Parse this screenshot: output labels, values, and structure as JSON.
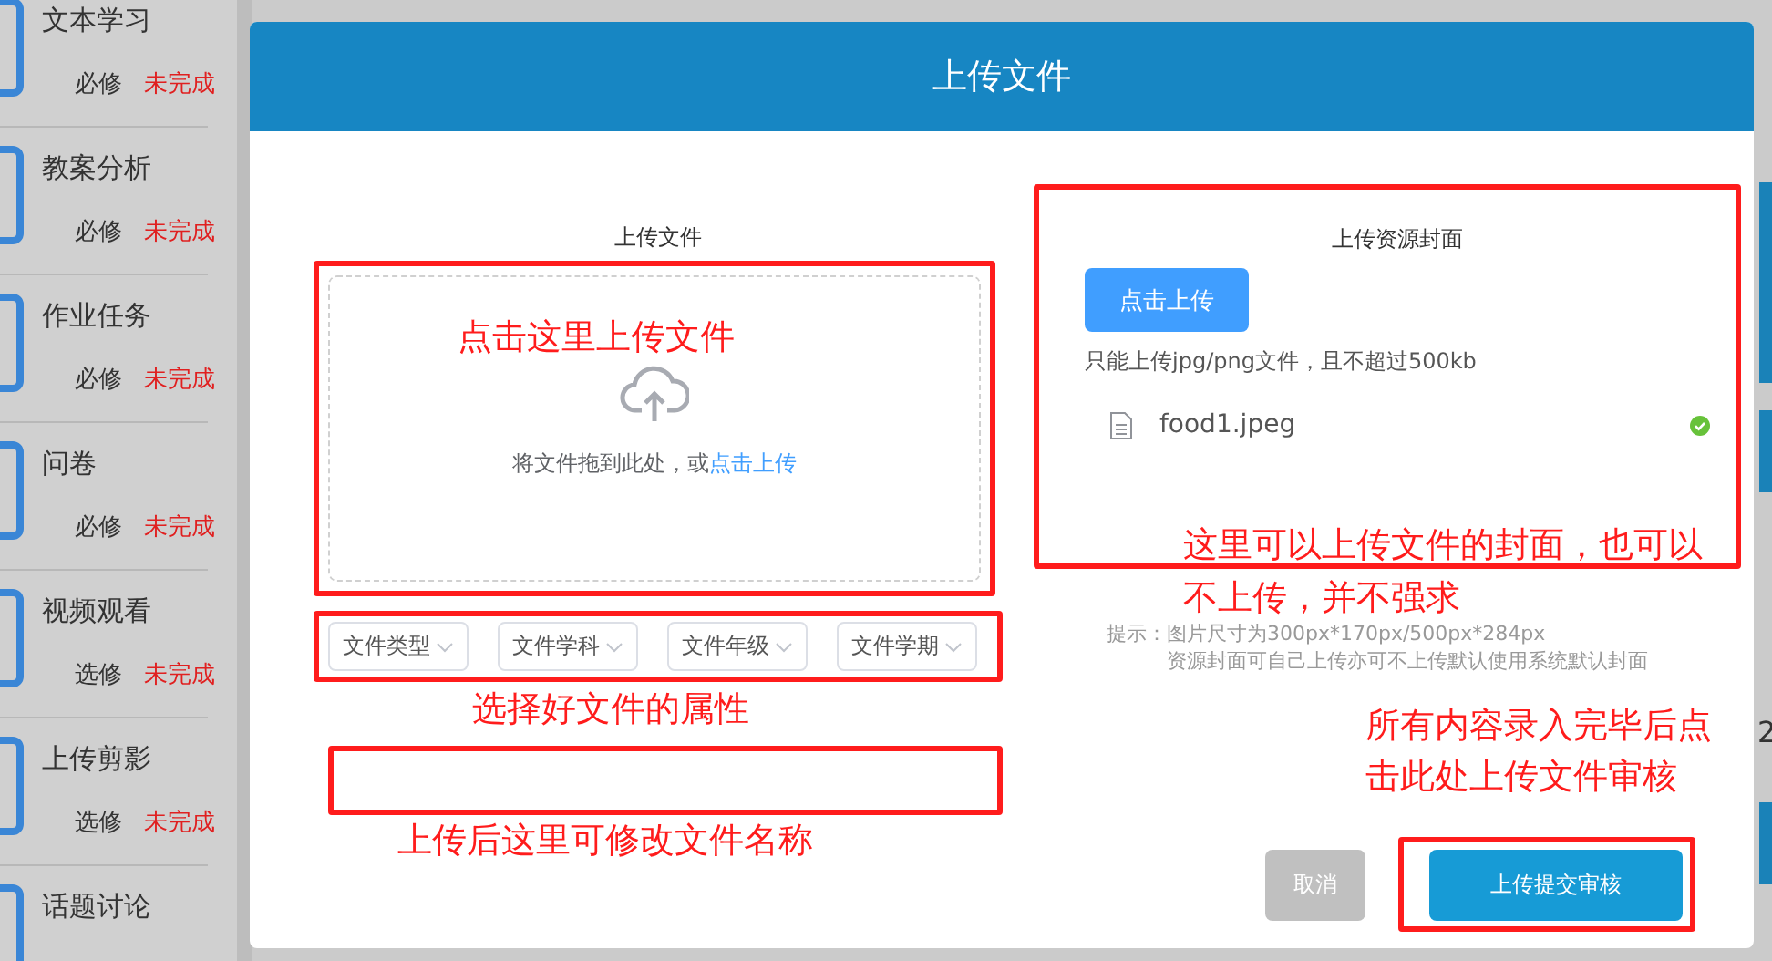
{
  "sidebar": {
    "items": [
      {
        "title": "文本学习",
        "type": "必修",
        "status": "未完成"
      },
      {
        "title": "教案分析",
        "type": "必修",
        "status": "未完成"
      },
      {
        "title": "作业任务",
        "type": "必修",
        "status": "未完成"
      },
      {
        "title": "问卷",
        "type": "必修",
        "status": "未完成"
      },
      {
        "title": "视频观看",
        "type": "选修",
        "status": "未完成"
      },
      {
        "title": "上传剪影",
        "type": "选修",
        "status": "未完成"
      },
      {
        "title": "话题讨论"
      }
    ]
  },
  "background_right": {
    "text": "2"
  },
  "dialog": {
    "title": "上传文件",
    "upload": {
      "label": "上传文件",
      "annotation": "点击这里上传文件",
      "hint": "将文件拖到此处，或",
      "link": "点击上传"
    },
    "selects": [
      {
        "placeholder": "文件类型"
      },
      {
        "placeholder": "文件学科"
      },
      {
        "placeholder": "文件年级"
      },
      {
        "placeholder": "文件学期"
      }
    ],
    "selects_annotation": "选择好文件的属性",
    "name_annotation": "上传后这里可修改文件名称",
    "cover": {
      "label": "上传资源封面",
      "button": "点击上传",
      "tip": "只能上传jpg/png文件，且不超过500kb",
      "files": [
        {
          "name": "food1.jpeg",
          "uploaded": true
        }
      ],
      "annotation": "这里可以上传文件的封面，也可以不上传，并不强求"
    },
    "hint": {
      "label": "提示：",
      "lines": [
        "图片尺寸为300px*170px/500px*284px",
        "资源封面可自己上传亦可不上传默认使用系统默认封面"
      ]
    },
    "submit_annotation": "所有内容录入完毕后点击此处上传文件审核",
    "buttons": [
      {
        "label": "取消",
        "kind": "cancel"
      },
      {
        "label": "上传提交审核",
        "kind": "primary"
      }
    ]
  }
}
